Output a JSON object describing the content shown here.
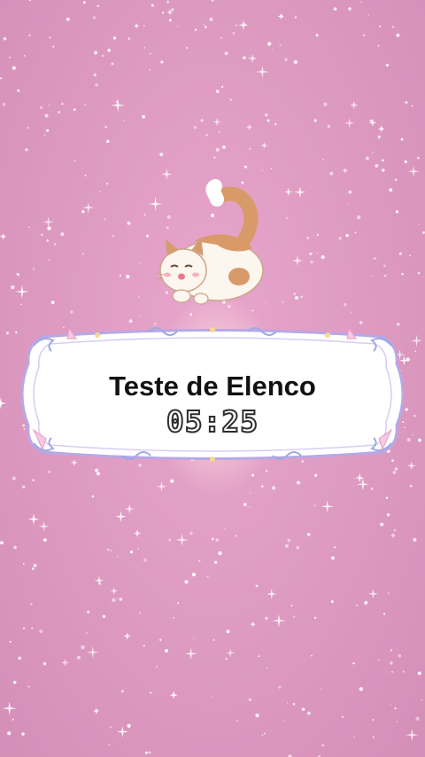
{
  "card": {
    "title": "Teste de Elenco",
    "timer": "05:25"
  },
  "colors": {
    "background": "#df9cc2",
    "frame_border": "#b7a8e6",
    "title_text": "#111111"
  },
  "decorations": {
    "mascot": "cat-icon",
    "background": "sparkles"
  }
}
